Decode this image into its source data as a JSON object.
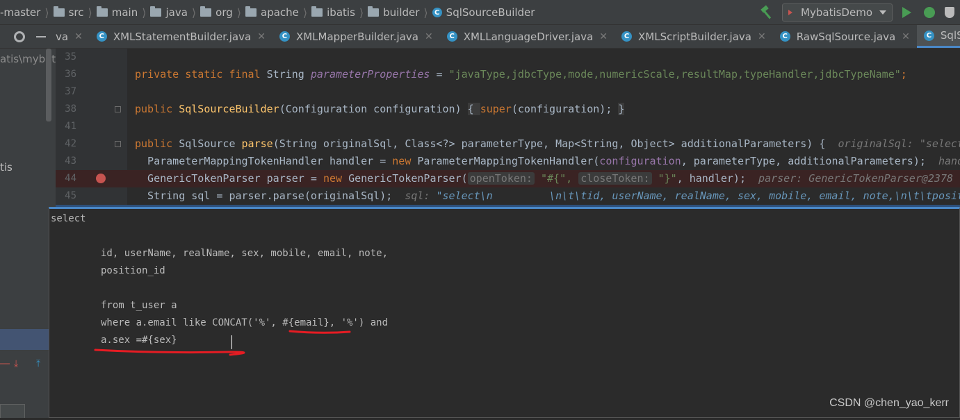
{
  "breadcrumb": {
    "items": [
      "-master",
      "src",
      "main",
      "java",
      "org",
      "apache",
      "ibatis",
      "builder",
      "SqlSourceBuilder"
    ]
  },
  "run_config": {
    "label": "MybatisDemo"
  },
  "tabs": [
    {
      "label": "va",
      "active": false
    },
    {
      "label": "XMLStatementBuilder.java",
      "active": false
    },
    {
      "label": "XMLMapperBuilder.java",
      "active": false
    },
    {
      "label": "XMLLanguageDriver.java",
      "active": false
    },
    {
      "label": "XMLScriptBuilder.java",
      "active": false
    },
    {
      "label": "RawSqlSource.java",
      "active": false
    },
    {
      "label": "SqlSourceB",
      "active": true
    }
  ],
  "project": {
    "path": "atis\\mybatis",
    "node": "tis"
  },
  "editor": {
    "line_numbers": [
      "35",
      "36",
      "37",
      "38",
      "41",
      "42",
      "43",
      "44",
      "45"
    ],
    "line36": {
      "kw": "private static final ",
      "type": "String ",
      "field": "parameterProperties",
      "eq": " = ",
      "str": "\"javaType,jdbcType,mode,numericScale,resultMap,typeHandler,jdbcTypeName\"",
      "end": ";"
    },
    "line38": {
      "kw": "public ",
      "fn": "SqlSourceBuilder",
      "args": "(Configuration configuration) ",
      "brace1": "{ ",
      "super_kw": "super",
      "super_args": "(configuration); ",
      "brace2": "}"
    },
    "line42": {
      "kw": "public ",
      "type": "SqlSource ",
      "fn": "parse",
      "args": "(String originalSql, Class<?> parameterType, Map<String, Object> additionalParameters) {",
      "debug": "  originalSql: \"select\\n"
    },
    "line43": {
      "pre": "  ParameterMappingTokenHandler handler = ",
      "kw": "new ",
      "post": "ParameterMappingTokenHandler(",
      "field": "configuration",
      "rest": ", parameterType, additionalParameters);",
      "debug": "  handl"
    },
    "line44": {
      "pre": "  GenericTokenParser parser = ",
      "kw": "new ",
      "post": "GenericTokenParser(",
      "hint1": "openToken:",
      "str1": " \"#{\", ",
      "hint2": "closeToken:",
      "str2": " \"}\"",
      "rest": ", handler);",
      "debug": "  parser: GenericTokenParser@2378"
    },
    "line45": {
      "pre": "  String sql = parser.parse(originalSql);",
      "debug_label": "  sql: ",
      "debug_val": "\"select\\n         \\n\\t\\tid, userName, realName, sex, mobile, email, note,\\n\\t\\tpositi"
    }
  },
  "popup": {
    "lines": [
      "select",
      "id, userName, realName, sex, mobile, email, note,",
      "position_id",
      "from t_user a",
      "where a.email like CONCAT('%', #{email}, '%') and",
      "a.sex =#{sex}"
    ]
  },
  "colors": {
    "accent": "#4a88c7",
    "annotation": "#e51c23",
    "breakpoint": "#c75450"
  },
  "watermark": "CSDN @chen_yao_kerr"
}
